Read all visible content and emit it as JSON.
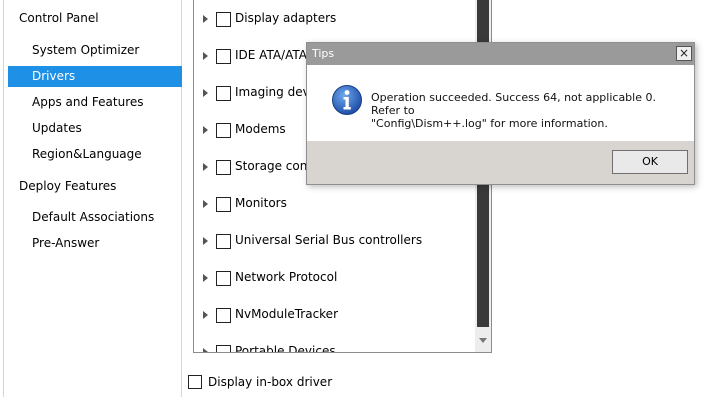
{
  "sidebar": {
    "groups": [
      {
        "label": "Control Panel",
        "items": [
          {
            "label": "System Optimizer"
          },
          {
            "label": "Drivers"
          },
          {
            "label": "Apps and Features"
          },
          {
            "label": "Updates"
          },
          {
            "label": "Region&Language"
          }
        ]
      },
      {
        "label": "Deploy Features",
        "items": [
          {
            "label": "Default Associations"
          },
          {
            "label": "Pre-Answer"
          }
        ]
      }
    ],
    "selected_item": "Drivers"
  },
  "driver_tree": {
    "items": [
      {
        "label": "Display adapters"
      },
      {
        "label": "IDE ATA/ATAPI controllers"
      },
      {
        "label": "Imaging devices"
      },
      {
        "label": "Modems"
      },
      {
        "label": "Storage controllers"
      },
      {
        "label": "Monitors"
      },
      {
        "label": "Universal Serial Bus controllers"
      },
      {
        "label": "Network Protocol"
      },
      {
        "label": "NvModuleTracker"
      },
      {
        "label": "Portable Devices"
      }
    ]
  },
  "footer": {
    "inbox_driver_label": "Display in-box driver"
  },
  "dialog": {
    "title": "Tips",
    "close_glyph": "×",
    "message_line1": "Operation succeeded. Success 64, not applicable 0. Refer to",
    "message_line2": "\"Config\\Dism++.log\" for more information.",
    "ok_label": "OK",
    "icon": "info-icon"
  },
  "colors": {
    "selection": "#1e90e6",
    "dialog_title_bar": "#9a9a9a",
    "dialog_footer": "#d8d5d0",
    "info_icon": "#1f5fbf"
  }
}
